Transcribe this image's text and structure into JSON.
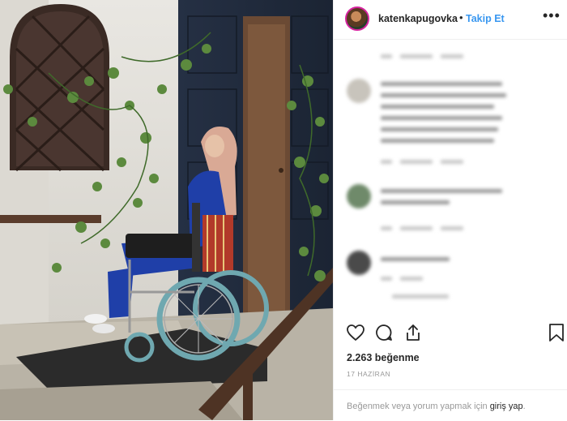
{
  "post": {
    "username": "katenkapugovka",
    "separator": "•",
    "follow_label": "Takip Et",
    "more_label": "•••",
    "likes": "2.263 beğenme",
    "date": "17 HAZİRAN",
    "login_prefix": "Beğenmek veya yorum yapmak için ",
    "login_link": "giriş yap",
    "login_suffix": "."
  },
  "photo": {
    "description_icon": "photo-woman-wheelchair-doorway"
  },
  "icons": {
    "like": "heart-icon",
    "comment": "comment-icon",
    "share": "share-icon",
    "save": "bookmark-icon"
  },
  "colors": {
    "accent": "#3897f0",
    "text": "#262626",
    "muted": "#999999",
    "divider": "#efefef"
  }
}
